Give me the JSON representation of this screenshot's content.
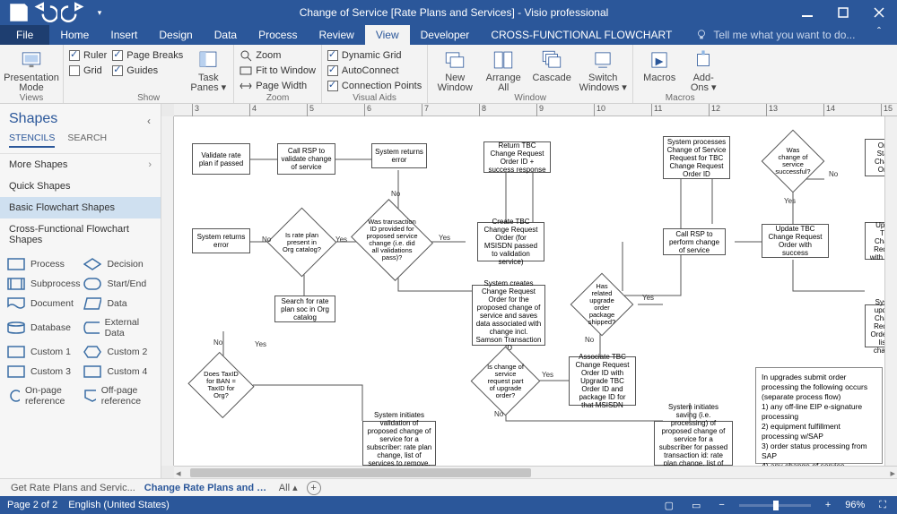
{
  "titlebar": {
    "title": "Change of Service [Rate Plans and Services] - Visio professional"
  },
  "tabs": {
    "file": "File",
    "items": [
      "Home",
      "Insert",
      "Design",
      "Data",
      "Process",
      "Review",
      "View",
      "Developer",
      "CROSS-FUNCTIONAL FLOWCHART"
    ],
    "active": 6,
    "tellme": "Tell me what you want to do..."
  },
  "ribbon": {
    "views": {
      "label": "Views",
      "presentation_l1": "Presentation",
      "presentation_l2": "Mode"
    },
    "show": {
      "label": "Show",
      "ruler": "Ruler",
      "pagebreaks": "Page Breaks",
      "grid": "Grid",
      "guides": "Guides",
      "taskpanes_l1": "Task",
      "taskpanes_l2": "Panes"
    },
    "zoom": {
      "label": "Zoom",
      "zoom": "Zoom",
      "fit": "Fit to Window",
      "width": "Page Width"
    },
    "visualaids": {
      "label": "Visual Aids",
      "dyn": "Dynamic Grid",
      "auto": "AutoConnect",
      "conn": "Connection Points"
    },
    "window": {
      "label": "Window",
      "new_l1": "New",
      "new_l2": "Window",
      "arrange_l1": "Arrange",
      "arrange_l2": "All",
      "cascade": "Cascade",
      "switch_l1": "Switch",
      "switch_l2": "Windows"
    },
    "macros": {
      "label": "Macros",
      "macros": "Macros",
      "addons_l1": "Add-",
      "addons_l2": "Ons"
    }
  },
  "shapes_panel": {
    "title": "Shapes",
    "tab_stencils": "STENCILS",
    "tab_search": "SEARCH",
    "more": "More Shapes",
    "quick": "Quick Shapes",
    "basic": "Basic Flowchart Shapes",
    "cross": "Cross-Functional Flowchart Shapes",
    "items": [
      "Process",
      "Decision",
      "Subprocess",
      "Start/End",
      "Document",
      "Data",
      "Database",
      "External Data",
      "Custom 1",
      "Custom 2",
      "Custom 3",
      "Custom 4",
      "On-page reference",
      "Off-page reference"
    ]
  },
  "ruler_marks": [
    "3",
    "4",
    "5",
    "6",
    "7",
    "8",
    "9",
    "10",
    "11",
    "12",
    "13",
    "14",
    "15"
  ],
  "flow": {
    "b1": "Validate rate plan if passed",
    "b2": "Call RSP to validate change of service",
    "b3": "System returns error",
    "b4": "Return TBC Change Request Order ID + success response",
    "b5": "System processes Change of Service Request for TBC Change Request Order ID",
    "b6": "Order Status Change Order",
    "b7": "System returns error",
    "d1": "Is rate plan present in Org catalog?",
    "d2": "Was transaction ID provided for proposed service change (i.e. did all validations pass)?",
    "b8": "Create TBC Change Request Order (for MSISDN passed to validation service)",
    "b9": "Call RSP to perform change of service",
    "b10": "Update TBC Change Request Order with success",
    "b11": "Update TBC Change Request with failure",
    "d3": "Was change of service successful?",
    "b12": "Search for rate plan soc in Org catalog",
    "b13": "System creates Change Request Order for the proposed change of service and saves data associated with change incl. Samson Transaction ID",
    "d4": "Has related upgrade order package shipped?",
    "b14": "System updates Change Request Order with list of changes",
    "d5": "Does TaxID for BAN = TaxID for Org?",
    "d6": "Is change of service request part of upgrade order?",
    "b15": "Associate TBC Change Request Order ID with Upgrade TBC Order ID and package ID for that MSISDN",
    "b16": "System initiates validation of proposed change of service for a subscriber: rate plan change, list of services to remove, list of",
    "b17": "System initiates saving (i.e. processing) of proposed change of service for a subscriber for passed transaction id: rate plan change, list of services to remove, list of",
    "note": "In upgrades submit order processing the following occurs (separate process flow)\n1) any off-line EIP e-signature processing\n2) equipment fulfillment processing w/SAP\n3) order status processing from SAP\n4) any change of service processing (shown here)",
    "yes": "Yes",
    "no": "No"
  },
  "pagetabs": {
    "p1": "Get Rate Plans and Servic...",
    "p2": "Change Rate Plans and Se...",
    "all": "All"
  },
  "status": {
    "page": "Page 2 of 2",
    "lang": "English (United States)",
    "zoom": "96%"
  }
}
